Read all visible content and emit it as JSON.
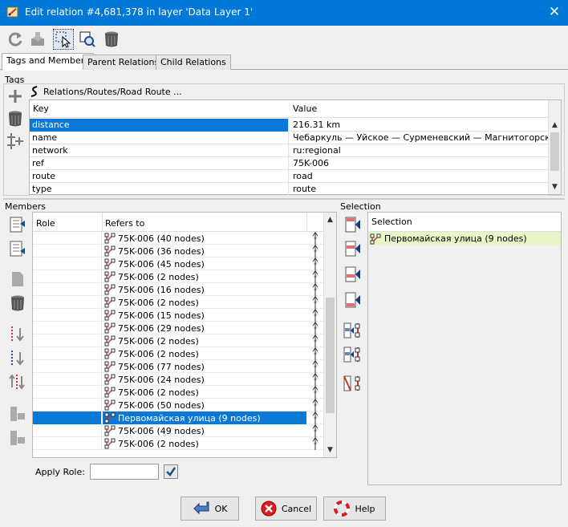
{
  "window": {
    "title": "Edit relation #4,681,378 in layer 'Data Layer 1'",
    "close_glyph": "✕"
  },
  "toolbar": {
    "icons": [
      "refresh-icon",
      "download-icon",
      "select-relation-icon",
      "zoom-relation-icon",
      "delete-icon"
    ]
  },
  "tabs": [
    {
      "label": "Tags and Members",
      "active": true
    },
    {
      "label": "Parent Relations",
      "active": false
    },
    {
      "label": "Child Relations",
      "active": false
    }
  ],
  "tags": {
    "section_label": "Tags",
    "preset_label": "Relations/Routes/Road Route ...",
    "columns": {
      "key": "Key",
      "value": "Value"
    },
    "rows": [
      {
        "key": "distance",
        "value": "216.31 km",
        "selected": true
      },
      {
        "key": "name",
        "value": "Чебаркуль — Уйское — Сурменевский — Магнитогорск",
        "selected": false
      },
      {
        "key": "network",
        "value": "ru:regional",
        "selected": false
      },
      {
        "key": "ref",
        "value": "75K-006",
        "selected": false
      },
      {
        "key": "route",
        "value": "road",
        "selected": false
      },
      {
        "key": "type",
        "value": "route",
        "selected": false
      }
    ]
  },
  "members": {
    "section_label": "Members",
    "columns": {
      "role": "Role",
      "refers_to": "Refers to"
    },
    "rows": [
      {
        "label": "75K-006 (40 nodes)",
        "selected": false
      },
      {
        "label": "75K-006 (36 nodes)",
        "selected": false
      },
      {
        "label": "75K-006 (45 nodes)",
        "selected": false
      },
      {
        "label": "75K-006 (2 nodes)",
        "selected": false
      },
      {
        "label": "75K-006 (16 nodes)",
        "selected": false
      },
      {
        "label": "75K-006 (2 nodes)",
        "selected": false
      },
      {
        "label": "75K-006 (15 nodes)",
        "selected": false
      },
      {
        "label": "75K-006 (29 nodes)",
        "selected": false
      },
      {
        "label": "75K-006 (2 nodes)",
        "selected": false
      },
      {
        "label": "75K-006 (2 nodes)",
        "selected": false
      },
      {
        "label": "75K-006 (77 nodes)",
        "selected": false
      },
      {
        "label": "75K-006 (24 nodes)",
        "selected": false
      },
      {
        "label": "75K-006 (2 nodes)",
        "selected": false
      },
      {
        "label": "75K-006 (50 nodes)",
        "selected": false
      },
      {
        "label": "Первомайская улица (9 nodes)",
        "selected": true
      },
      {
        "label": "75K-006 (49 nodes)",
        "selected": false
      },
      {
        "label": "75K-006 (2 nodes)",
        "selected": false
      }
    ],
    "apply_role_label": "Apply Role:",
    "apply_role_value": ""
  },
  "selection": {
    "section_label": "Selection",
    "column": "Selection",
    "rows": [
      {
        "label": "Первомайская улица (9 nodes)"
      }
    ]
  },
  "buttons": {
    "ok": "OK",
    "cancel": "Cancel",
    "help": "Help"
  },
  "colors": {
    "titlebar": "#0078d7",
    "selection_row": "#0a78d7",
    "selection_list_row": "#e8f5c8",
    "way_icon": "#c0392b"
  }
}
